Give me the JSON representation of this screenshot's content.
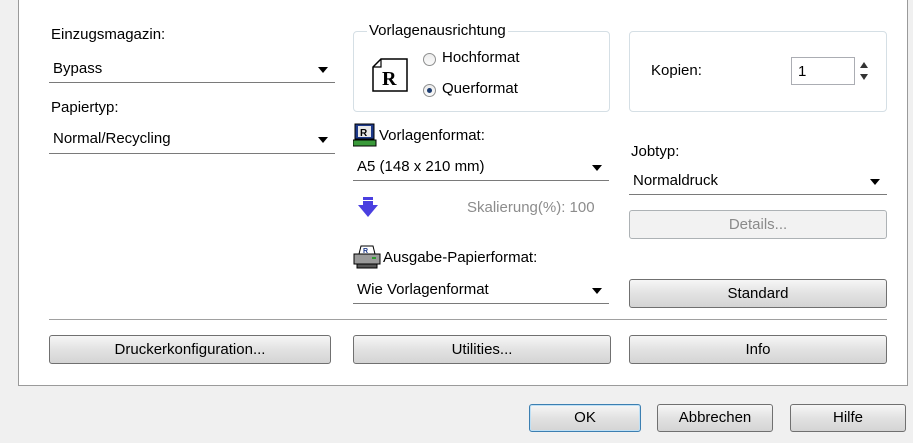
{
  "left": {
    "tray_label": "Einzugsmagazin:",
    "tray_value": "Bypass",
    "paper_type_label": "Papiertyp:",
    "paper_type_value": "Normal/Recycling"
  },
  "orientation": {
    "group_label": "Vorlagenausrichtung",
    "icon_letter": "R",
    "portrait_label": "Hochformat",
    "landscape_label": "Querformat",
    "selected": "Querformat"
  },
  "copies": {
    "label": "Kopien:",
    "value": "1"
  },
  "original_format": {
    "label": "Vorlagenformat:",
    "value": "A5 (148 x 210 mm)",
    "scaling_text": "Skalierung(%): 100"
  },
  "output_format": {
    "label": "Ausgabe-Papierformat:",
    "value": "Wie Vorlagenformat"
  },
  "job": {
    "label": "Jobtyp:",
    "value": "Normaldruck",
    "details_button": "Details...",
    "standard_button": "Standard"
  },
  "bottom_buttons": {
    "printer_config": "Druckerkonfiguration...",
    "utilities": "Utilities...",
    "info": "Info"
  },
  "dialog_buttons": {
    "ok": "OK",
    "cancel": "Abbrechen",
    "help": "Hilfe"
  },
  "icons": {
    "orientation": "document-r-icon",
    "original_format": "monitor-r-icon",
    "scaling": "down-arrow-icon",
    "output_format": "printer-icon"
  },
  "colors": {
    "scaling_arrow": "#4a3fe0",
    "default_button_border": "#3c7fb1"
  }
}
